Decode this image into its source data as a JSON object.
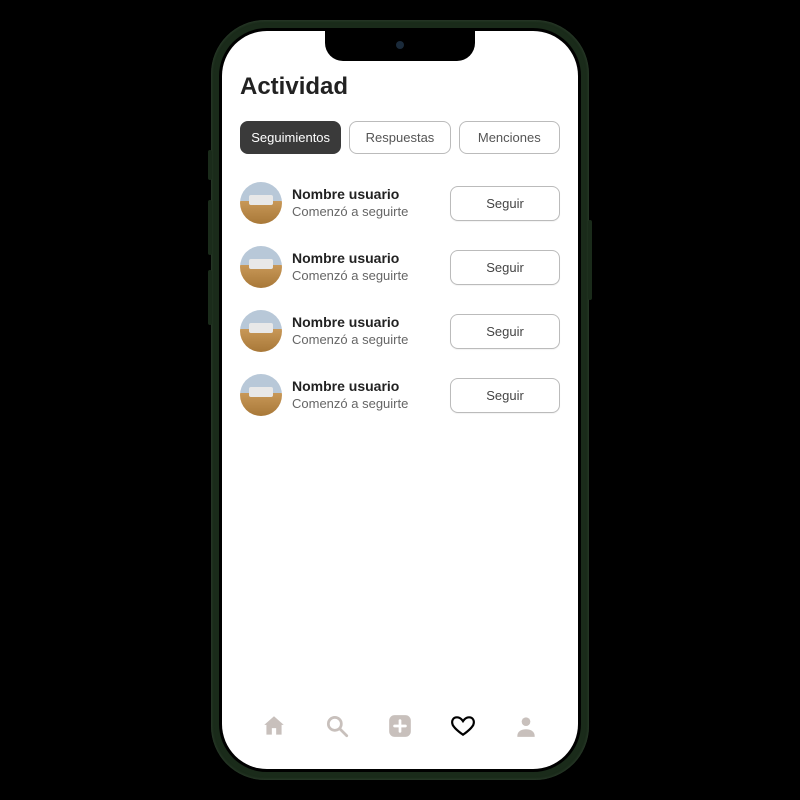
{
  "page": {
    "title": "Actividad"
  },
  "tabs": [
    {
      "label": "Seguimientos",
      "active": true
    },
    {
      "label": "Respuestas",
      "active": false
    },
    {
      "label": "Menciones",
      "active": false
    }
  ],
  "activity": [
    {
      "username": "Nombre usuario",
      "subtitle": "Comenzó a seguirte",
      "action": "Seguir"
    },
    {
      "username": "Nombre usuario",
      "subtitle": "Comenzó a seguirte",
      "action": "Seguir"
    },
    {
      "username": "Nombre usuario",
      "subtitle": "Comenzó a seguirte",
      "action": "Seguir"
    },
    {
      "username": "Nombre usuario",
      "subtitle": "Comenzó a seguirte",
      "action": "Seguir"
    }
  ],
  "nav": {
    "home": "home",
    "search": "search",
    "create": "create",
    "activity": "activity",
    "profile": "profile",
    "active": "activity"
  }
}
